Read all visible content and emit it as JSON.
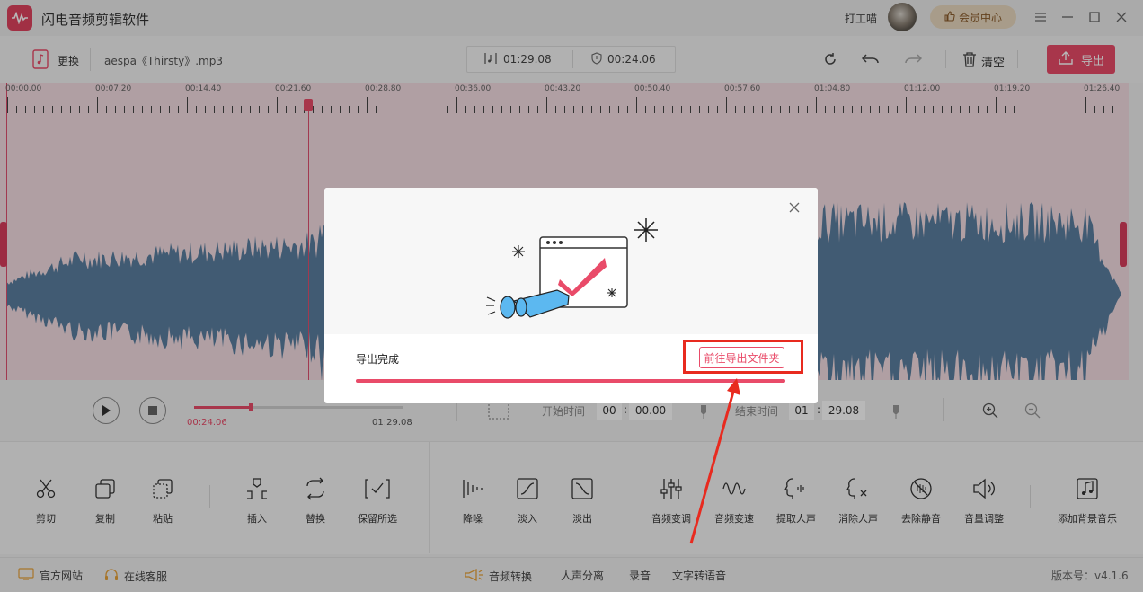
{
  "app": {
    "title": "闪电音频剪辑软件",
    "user": "打工喵",
    "vip": "会员中心"
  },
  "toolbar": {
    "change": "更换",
    "filename": "aespa《Thirsty》.mp3",
    "duration": "01:29.08",
    "position": "00:24.06",
    "clear": "清空",
    "export": "导出"
  },
  "ruler": [
    "00:00.00",
    "00:07.20",
    "00:14.40",
    "00:21.60",
    "00:28.80",
    "00:36.00",
    "00:43.20",
    "00:50.40",
    "00:57.60",
    "01:04.80",
    "01:12.00",
    "01:19.20",
    "01:26.40"
  ],
  "player": {
    "current": "00:24.06",
    "total": "01:29.08",
    "progress": 0.27
  },
  "segment": {
    "start_label": "开始时间",
    "start_min": "00",
    "start_sec": "00.00",
    "end_label": "结束时间",
    "end_min": "01",
    "end_sec": "29.08",
    "colon": ":"
  },
  "tools": [
    {
      "label": "剪切",
      "icon": "scissors-icon"
    },
    {
      "label": "复制",
      "icon": "copy-icon"
    },
    {
      "label": "粘贴",
      "icon": "paste-icon"
    },
    {
      "label": "插入",
      "icon": "insert-icon"
    },
    {
      "label": "替换",
      "icon": "replace-icon"
    },
    {
      "label": "保留所选",
      "icon": "keep-selection-icon"
    },
    {
      "label": "降噪",
      "icon": "denoise-icon"
    },
    {
      "label": "淡入",
      "icon": "fade-in-icon"
    },
    {
      "label": "淡出",
      "icon": "fade-out-icon"
    },
    {
      "label": "音频变调",
      "icon": "pitch-icon"
    },
    {
      "label": "音频变速",
      "icon": "speed-icon"
    },
    {
      "label": "提取人声",
      "icon": "extract-vocal-icon"
    },
    {
      "label": "消除人声",
      "icon": "remove-vocal-icon"
    },
    {
      "label": "去除静音",
      "icon": "remove-silence-icon"
    },
    {
      "label": "音量调整",
      "icon": "volume-icon"
    },
    {
      "label": "添加背景音乐",
      "icon": "music-note-icon"
    }
  ],
  "footer": {
    "website": "官方网站",
    "service": "在线客服",
    "convert": "音频转换",
    "separate": "人声分离",
    "record": "录音",
    "tts": "文字转语音",
    "version": "版本号：v4.1.6"
  },
  "dialog": {
    "title": "导出完成",
    "open_folder": "前往导出文件夹",
    "progress": 1.0
  },
  "colors": {
    "accent": "#e94b69",
    "wave": "#5a7fa0",
    "highlight": "#e82a1f"
  }
}
